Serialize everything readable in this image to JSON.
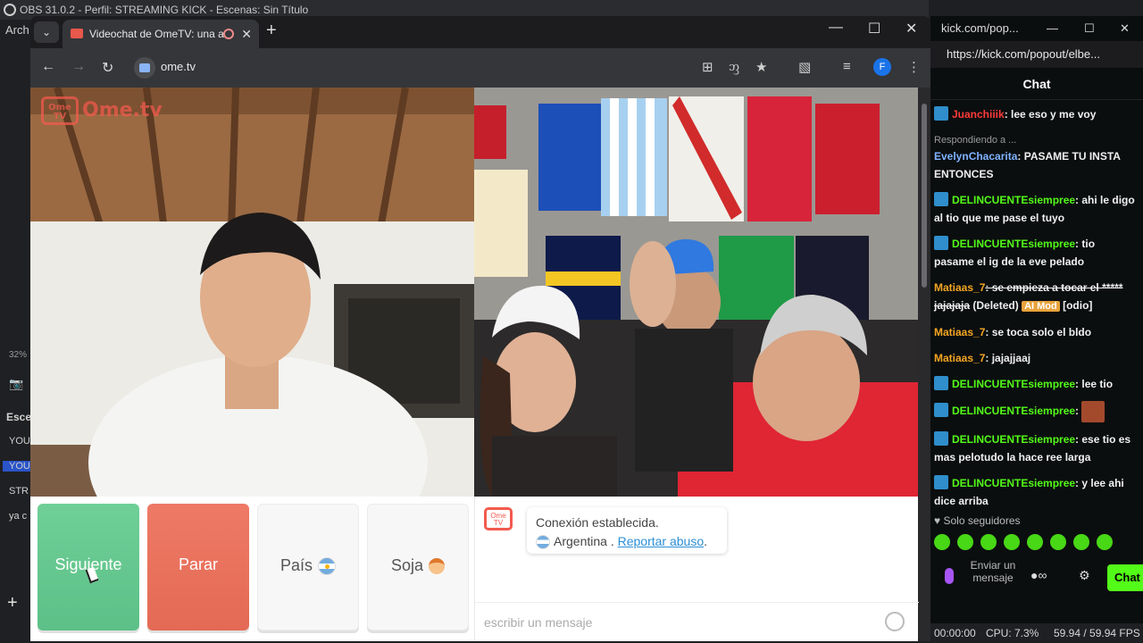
{
  "obs": {
    "title": "OBS 31.0.2 - Perfil: STREAMING KICK - Escenas: Sin Título",
    "menu_first": "Arch",
    "zoom": "32%",
    "scenes_header": "Esce",
    "scenes": [
      "YOU",
      "YOU",
      "STR",
      "ya c"
    ],
    "status_time": "00:00:00",
    "status_cpu": "CPU: 7.3%",
    "status_fps": "59.94 / 59.94 FPS"
  },
  "browser": {
    "tab_title": "Videochat de OmeTV: una a",
    "url": "ome.tv",
    "profile_initial": "F"
  },
  "ometv": {
    "logo_badge": "Ome TV",
    "logo_text": "Ome.tv",
    "buttons": {
      "next": "Siguiente",
      "stop": "Parar",
      "country": "País",
      "gender": "Soja"
    },
    "chat": {
      "status": "Conexión establecida.",
      "country": "Argentina .",
      "report": "Reportar abuso",
      "report_suffix": ".",
      "placeholder": "escribir un mensaje"
    }
  },
  "kick": {
    "tab_title": "kick.com/pop...",
    "url": "https://kick.com/popout/elbe...",
    "header": "Chat",
    "messages": [
      {
        "user": "Juanchiiik",
        "color": "#ff3b3b",
        "badge": true,
        "text": ": lee eso y me voy"
      },
      {
        "reply": "Respondiendo a ...",
        "user": "EvelynChacarita",
        "color": "#7fb2ff",
        "badge": false,
        "text": ": PASAME TU INSTA ENTONCES"
      },
      {
        "user": "DELINCUENTEsiempree",
        "color": "#53fc18",
        "badge": true,
        "text": ": ahi le digo al tio que me pase el tuyo"
      },
      {
        "user": "DELINCUENTEsiempree",
        "color": "#53fc18",
        "badge": true,
        "text": ": tio pasame el ig de la eve pelado"
      },
      {
        "user": "Matiaas_7",
        "color": "#f5a623",
        "badge": false,
        "text": ": se empieza a tocar el ***** jajajaja",
        "deleted": "(Deleted)",
        "mod": "AI Mod",
        "tag": "[odio]"
      },
      {
        "user": "Matiaas_7",
        "color": "#f5a623",
        "badge": false,
        "text": ": se toca solo el bldo"
      },
      {
        "user": "Matiaas_7",
        "color": "#f5a623",
        "badge": false,
        "text": ": jajajjaaj"
      },
      {
        "user": "DELINCUENTEsiempree",
        "color": "#53fc18",
        "badge": true,
        "text": ": lee tio"
      },
      {
        "user": "DELINCUENTEsiempree",
        "color": "#53fc18",
        "badge": true,
        "text": ":",
        "emote": true
      },
      {
        "user": "DELINCUENTEsiempree",
        "color": "#53fc18",
        "badge": true,
        "text": ": ese tio es mas pelotudo la hace ree larga"
      },
      {
        "user": "DELINCUENTEsiempree",
        "color": "#53fc18",
        "badge": true,
        "text": ": y lee ahi dice arriba"
      }
    ],
    "followers_only": "Solo seguidores",
    "send_placeholder": "Enviar un mensaje",
    "chat_button": "Chat"
  }
}
